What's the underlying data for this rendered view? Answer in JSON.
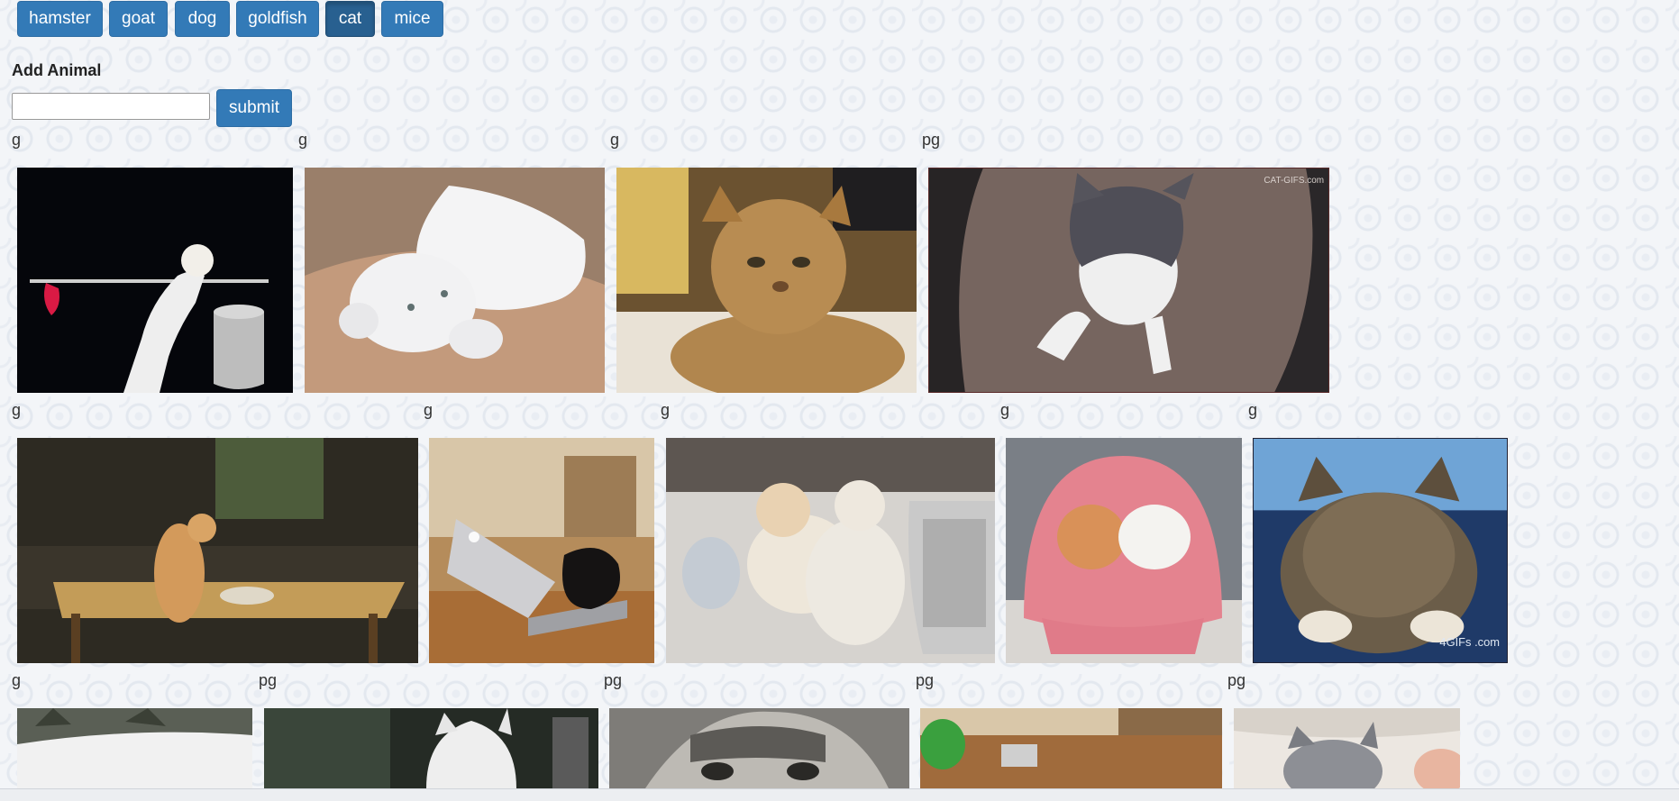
{
  "animal_buttons": [
    {
      "label": "hamster"
    },
    {
      "label": "goat"
    },
    {
      "label": "dog"
    },
    {
      "label": "goldfish"
    },
    {
      "label": "cat",
      "active": true
    },
    {
      "label": "mice"
    }
  ],
  "add_animal": {
    "heading": "Add Animal",
    "input_value": "",
    "submit_label": "submit"
  },
  "gif_results": [
    {
      "rating": "g",
      "watermark": ""
    },
    {
      "rating": "g",
      "watermark": ""
    },
    {
      "rating": "g",
      "watermark": ""
    },
    {
      "rating": "pg",
      "watermark": "CAT-GIFS.com"
    },
    {
      "rating": "g",
      "watermark": ""
    },
    {
      "rating": "g",
      "watermark": ""
    },
    {
      "rating": "g",
      "watermark": ""
    },
    {
      "rating": "g",
      "watermark": ""
    },
    {
      "rating": "g",
      "watermark": "4GIFs .com"
    },
    {
      "rating": "g",
      "watermark": ""
    },
    {
      "rating": "pg",
      "watermark": ""
    },
    {
      "rating": "pg",
      "watermark": ""
    },
    {
      "rating": "pg",
      "watermark": ""
    },
    {
      "rating": "pg",
      "watermark": ""
    }
  ],
  "colors": {
    "button_primary": "#337ab7",
    "button_active": "#286090"
  }
}
